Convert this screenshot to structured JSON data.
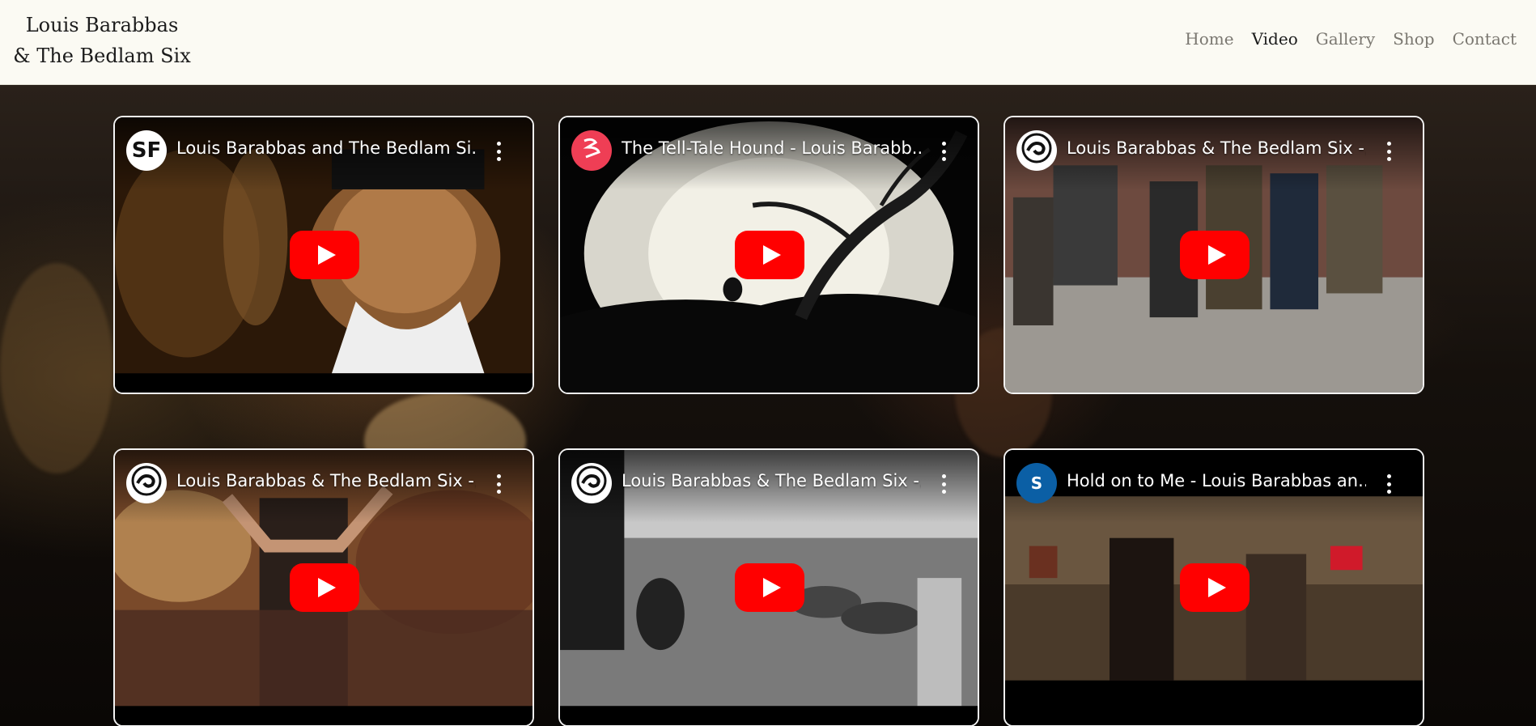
{
  "header": {
    "logo_line1": "Louis Barabbas",
    "logo_line2": "& The Bedlam Six"
  },
  "nav": {
    "items": [
      {
        "label": "Home",
        "active": false
      },
      {
        "label": "Video",
        "active": true
      },
      {
        "label": "Gallery",
        "active": false
      },
      {
        "label": "Shop",
        "active": false
      },
      {
        "label": "Contact",
        "active": false
      }
    ]
  },
  "videos": [
    {
      "title": "Louis Barabbas and The Bedlam Si...",
      "channel_initials": "SF",
      "avatar_bg": "#ffffff",
      "avatar_fg": "#111111",
      "icon": "sf-logo-icon"
    },
    {
      "title": "The Tell-Tale Hound - Louis Barabb...",
      "channel_initials": "",
      "avatar_bg": "#ef3e55",
      "avatar_fg": "#ffffff",
      "icon": "red-swirl-logo-icon"
    },
    {
      "title": "Louis Barabbas & The Bedlam Six -...",
      "channel_initials": "",
      "avatar_bg": "#ffffff",
      "avatar_fg": "#111111",
      "icon": "wave-logo-icon"
    },
    {
      "title": "Louis Barabbas & The Bedlam Six -...",
      "channel_initials": "",
      "avatar_bg": "#ffffff",
      "avatar_fg": "#111111",
      "icon": "wave-logo-icon"
    },
    {
      "title": "Louis Barabbas & The Bedlam Six -...",
      "channel_initials": "",
      "avatar_bg": "#ffffff",
      "avatar_fg": "#111111",
      "icon": "wave-logo-icon"
    },
    {
      "title": "Hold on to Me - Louis Barabbas an...",
      "channel_initials": "S",
      "avatar_bg": "#0b5fa5",
      "avatar_fg": "#ffffff",
      "icon": "s-letter-avatar-icon"
    }
  ],
  "colors": {
    "header_bg": "#fbfaf3",
    "play_button": "#ff0000",
    "card_border": "#f3f3f3"
  }
}
